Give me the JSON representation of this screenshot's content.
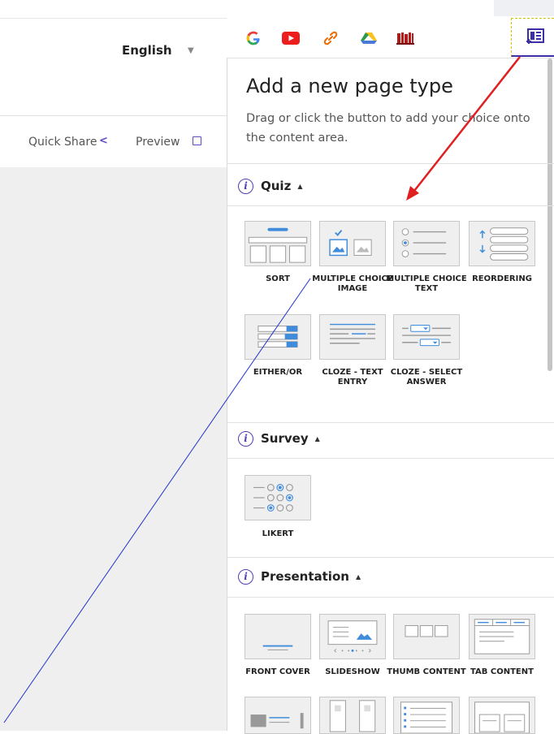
{
  "header": {
    "language": "English",
    "quick_share": "Quick Share",
    "preview": "Preview"
  },
  "toolbar": {
    "items": [
      "google-icon",
      "youtube-icon",
      "link-icon",
      "drive-icon",
      "library-icon",
      "add-page-type-icon"
    ]
  },
  "panel": {
    "title": "Add a new page type",
    "description": "Drag or click the button to add your choice onto the content area.",
    "sections": {
      "quiz": {
        "label": "Quiz",
        "items": [
          "SORT",
          "MULTIPLE CHOICE IMAGE",
          "MULTIPLE CHOICE TEXT",
          "REORDERING",
          "EITHER/OR",
          "CLOZE - TEXT ENTRY",
          "CLOZE - SELECT ANSWER"
        ]
      },
      "survey": {
        "label": "Survey",
        "items": [
          "LIKERT"
        ]
      },
      "presentation": {
        "label": "Presentation",
        "items": [
          "FRONT COVER",
          "SLIDESHOW",
          "THUMB CONTENT",
          "TAB CONTENT"
        ]
      }
    }
  },
  "colors": {
    "accent": "#4f3fb8",
    "tile_blue": "#3f8cdc",
    "annotation_red": "#e02020",
    "annotation_line": "#2233cc"
  }
}
